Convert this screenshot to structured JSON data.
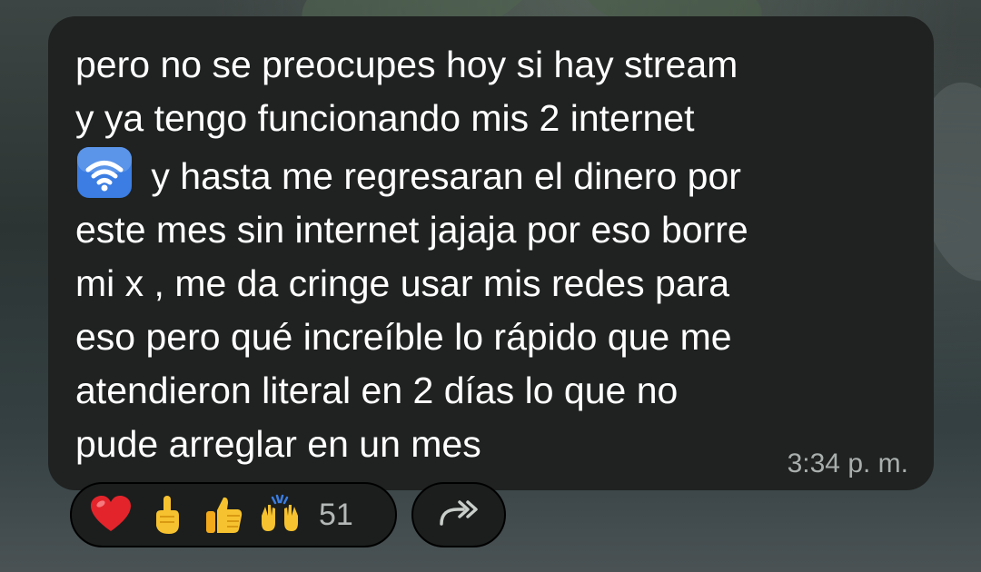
{
  "message": {
    "text_line1": "pero no se preocupes hoy si hay stream",
    "text_line2": "y ya tengo funcionando mis 2 internet",
    "wifi_emoji_icon": "wifi-emoji",
    "text_rest": " y hasta me regresaran el dinero por\neste mes sin internet jajaja por eso borre\nmi x , me da cringe usar mis redes para\neso pero qué increíble lo rápido que me\natendieron literal en 2 días lo que no\npude arreglar en un mes",
    "time": "3:34 p. m."
  },
  "reactions": {
    "items": [
      {
        "icon": "red-heart-emoji"
      },
      {
        "icon": "pointing-up-emoji"
      },
      {
        "icon": "thumbs-up-emoji"
      },
      {
        "icon": "raising-hands-emoji"
      }
    ],
    "count": "51"
  },
  "share": {
    "icon": "forward-share-icon"
  },
  "colors": {
    "bubble": "#1f2221",
    "text": "#ffffff",
    "timestamp": "#a9afad",
    "wifi_emoji_bg": "#3b7de2"
  }
}
